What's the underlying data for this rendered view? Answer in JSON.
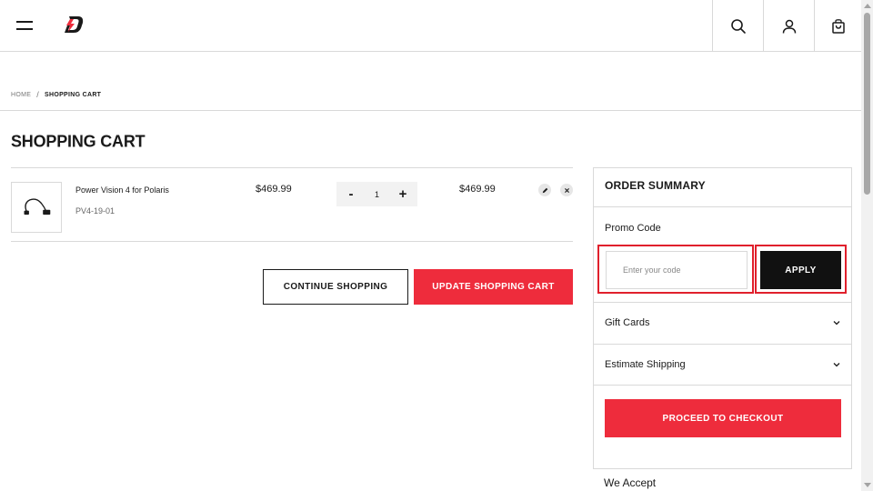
{
  "header": {
    "menu_icon": "hamburger-icon",
    "logo_icon": "brand-logo-icon",
    "search_icon": "search-icon",
    "account_icon": "user-icon",
    "cart_icon": "shopping-bag-icon"
  },
  "breadcrumb": {
    "home": "HOME",
    "separator": "/",
    "current": "SHOPPING CART"
  },
  "page": {
    "title": "SHOPPING CART"
  },
  "cart": {
    "items": [
      {
        "name": "Power Vision 4 for Polaris",
        "sku": "PV4-19-01",
        "price": "$469.99",
        "quantity": "1",
        "subtotal": "$469.99"
      }
    ],
    "qty_decrease": "-",
    "qty_increase": "+",
    "continue_label": "CONTINUE SHOPPING",
    "update_label": "UPDATE SHOPPING CART"
  },
  "summary": {
    "title": "ORDER SUMMARY",
    "promo_label": "Promo Code",
    "promo_placeholder": "Enter your code",
    "apply_label": "APPLY",
    "gift_cards_label": "Gift Cards",
    "estimate_shipping_label": "Estimate Shipping",
    "checkout_label": "PROCEED TO CHECKOUT",
    "we_accept_label": "We Accept"
  },
  "colors": {
    "brand_red": "#ee2c3c",
    "dark": "#111111",
    "highlight_border": "#e0202c"
  }
}
